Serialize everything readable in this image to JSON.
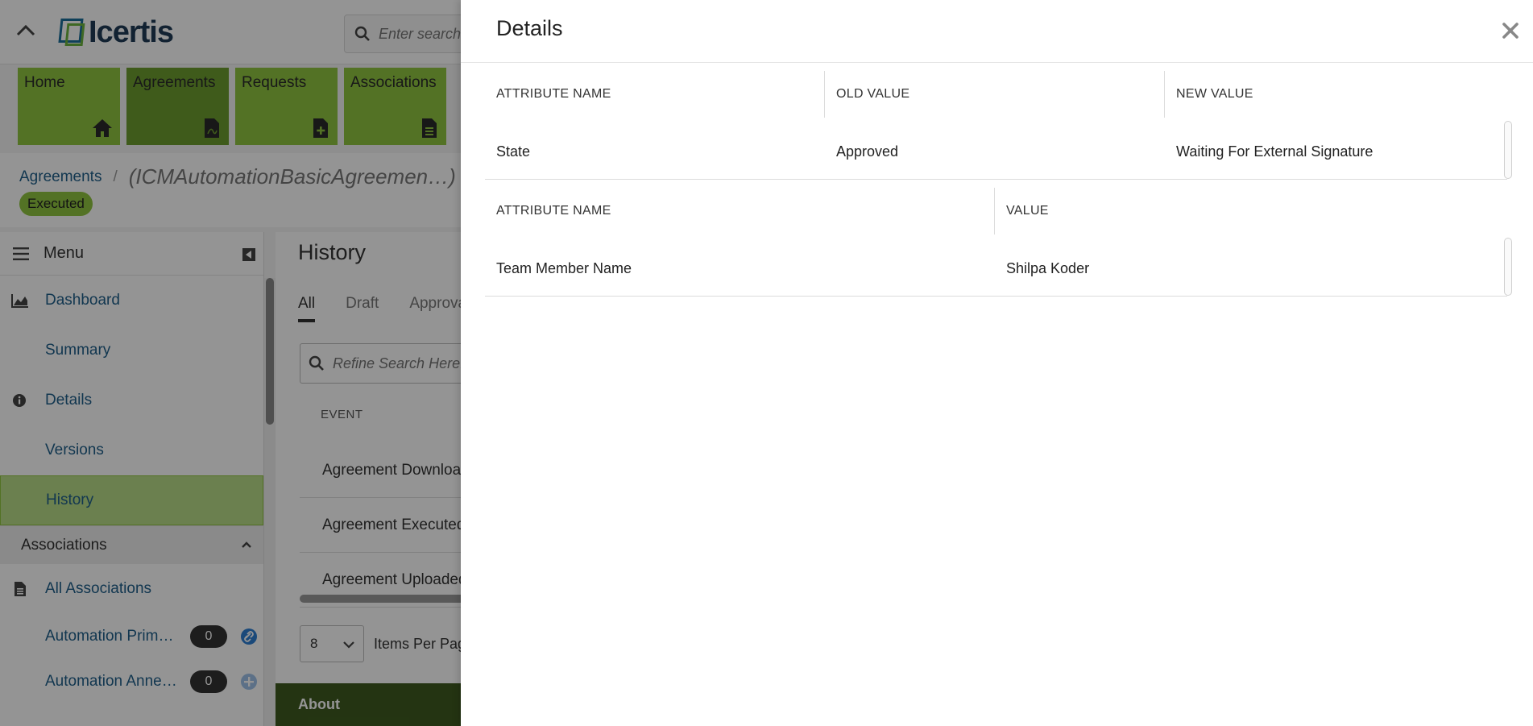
{
  "app": {
    "logo_text": "Icertis",
    "search_placeholder": "Enter search t",
    "tiles": [
      {
        "label": "Home",
        "icon": "home-icon"
      },
      {
        "label": "Agreements",
        "icon": "pdf-file-icon"
      },
      {
        "label": "Requests",
        "icon": "add-file-icon"
      },
      {
        "label": "Associations",
        "icon": "document-icon"
      }
    ],
    "breadcrumb": {
      "link": "Agreements",
      "separator": "/",
      "title": "(ICMAutomationBasicAgreemen…)"
    },
    "status_badge": "Executed"
  },
  "sidebar": {
    "menu_label": "Menu",
    "items": [
      {
        "label": "Dashboard",
        "icon": "chart-area-icon"
      },
      {
        "label": "Summary",
        "icon": ""
      },
      {
        "label": "Details",
        "icon": "info-circle-icon"
      },
      {
        "label": "Versions",
        "icon": ""
      },
      {
        "label": "History",
        "icon": "",
        "active": true
      }
    ],
    "associations_header": "Associations",
    "all_associations": "All Associations",
    "assoc_items": [
      {
        "label": "Automation Prime …",
        "count": "0",
        "icon": "link-icon"
      },
      {
        "label": "Automation Annex…",
        "count": "0",
        "icon": "add-circle-icon"
      }
    ]
  },
  "history": {
    "title": "History",
    "tabs": [
      "All",
      "Draft",
      "Approval"
    ],
    "search_placeholder": "Refine Search Here...",
    "column": "EVENT",
    "rows": [
      "Agreement Downloade",
      "Agreement Executed",
      "Agreement Uploaded S"
    ],
    "page_size": "8",
    "items_per_page": "Items Per Page",
    "about": "About"
  },
  "panel": {
    "title": "Details",
    "changes": {
      "headers": [
        "ATTRIBUTE NAME",
        "OLD VALUE",
        "NEW VALUE"
      ],
      "rows": [
        [
          "State",
          "Approved",
          "Waiting For External Signature"
        ]
      ]
    },
    "values": {
      "headers": [
        "ATTRIBUTE NAME",
        "VALUE"
      ],
      "rows": [
        [
          "Team Member Name",
          "Shilpa Koder"
        ]
      ]
    }
  },
  "colors": {
    "tile_green": "#8fc440",
    "tile_active": "#6d9d30",
    "link_blue": "#1f5f8b",
    "about_bar": "#3e5b1f"
  }
}
